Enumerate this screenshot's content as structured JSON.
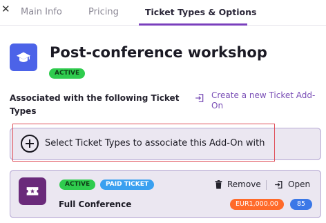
{
  "tabs": {
    "close_symbol": "✕",
    "items": [
      {
        "label": "Main Info"
      },
      {
        "label": "Pricing"
      },
      {
        "label": "Ticket Types & Options"
      }
    ],
    "active_index": 2
  },
  "addon": {
    "icon": "graduation-cap-icon",
    "title": "Post-conference workshop",
    "status": "ACTIVE"
  },
  "associations": {
    "label": "Associated with the following Ticket Types",
    "create_link": "Create a new Ticket Add-On",
    "create_link_icon": "enter-icon",
    "select_prompt": "Select Ticket Types to associate this Add-On with",
    "select_icon": "plus-circle-icon"
  },
  "ticket": {
    "icon": "ticket-icon",
    "status": "ACTIVE",
    "type": "PAID TICKET",
    "name": "Full Conference",
    "remove_label": "Remove",
    "remove_icon": "trash-icon",
    "open_label": "Open",
    "open_icon": "enter-icon",
    "price": "EUR1,000.00",
    "count": "85"
  },
  "colors": {
    "accent": "#7a3fbd",
    "addon_icon_bg": "#4c63e8",
    "ticket_icon_bg": "#6a2a7a",
    "active_badge": "#2fcc4e",
    "paid_badge": "#3aa0f0",
    "price_badge": "#ff6a2a",
    "count_badge": "#3b78e7",
    "highlight_frame": "#e0505a"
  }
}
